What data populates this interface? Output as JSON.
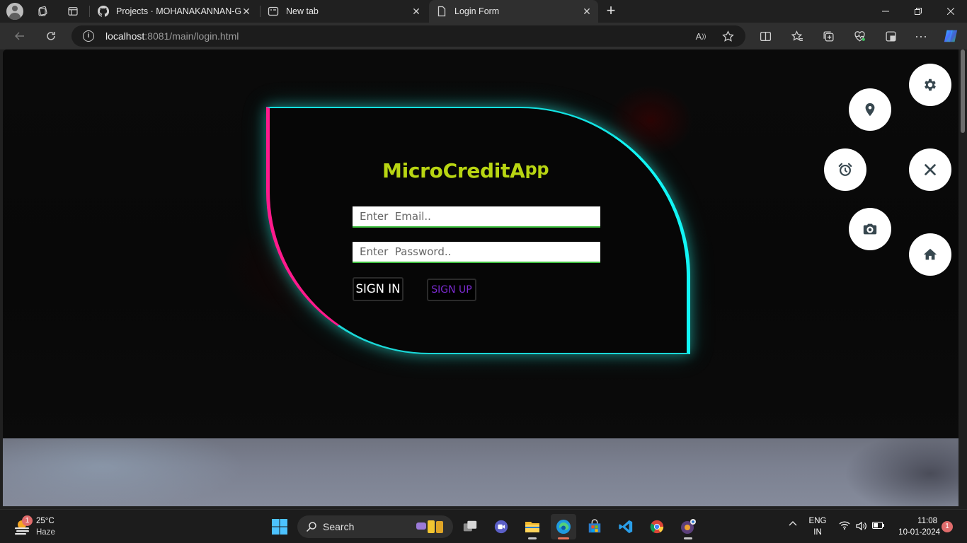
{
  "browser": {
    "tabs": [
      {
        "title": "Projects · MOHANAKANNAN-G",
        "icon": "github-icon"
      },
      {
        "title": "New tab",
        "icon": "newtab-icon"
      },
      {
        "title": "Login Form",
        "icon": "page-icon",
        "active": true
      }
    ],
    "url_host": "localhost",
    "url_rest": ":8081/main/login.html"
  },
  "page": {
    "brand_main": "MicroCreditA",
    "brand_sup": "pp",
    "email_placeholder": "Enter  Email..",
    "password_placeholder": "Enter  Password..",
    "signin_label": "SIGN IN",
    "signup_label": "SIGN UP",
    "colors": {
      "brand": "#b8d512",
      "left_border": "#ff1a8c",
      "right_border": "#12f5f5",
      "signup": "#7b2ad1"
    },
    "fab_icons": [
      "gear-icon",
      "location-pin-icon",
      "alarm-clock-icon",
      "close-icon",
      "camera-icon",
      "home-icon"
    ]
  },
  "taskbar": {
    "weather_badge": "1",
    "temperature": "25°C",
    "condition": "Haze",
    "search_label": "Search",
    "language": "ENG",
    "region": "IN",
    "time": "11:08",
    "date": "10-01-2024",
    "notifications": "1"
  }
}
